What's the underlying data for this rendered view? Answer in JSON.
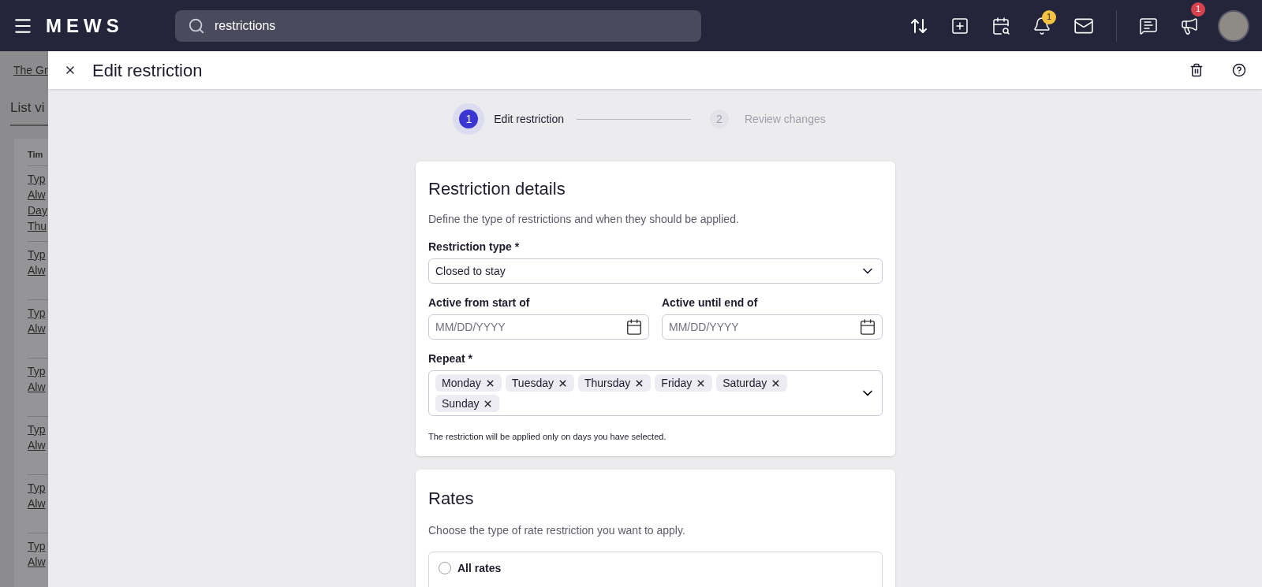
{
  "top_bar": {
    "logo": "MEWS",
    "search": {
      "value": "restrictions"
    },
    "notifications_badge": "1",
    "announcements_badge": "1"
  },
  "background_page": {
    "breadcrumb": "The Gr",
    "tab": "List vi",
    "table_header": "Tim",
    "rows": [
      [
        "Typ",
        "Alw",
        "Day",
        "Thu"
      ],
      [
        "Typ",
        "Alw"
      ],
      [
        "Typ",
        "Alw"
      ],
      [
        "Typ",
        "Alw"
      ],
      [
        "Typ",
        "Alw"
      ],
      [
        "Typ",
        "Alw"
      ],
      [
        "Typ",
        "Alw"
      ]
    ]
  },
  "panel": {
    "title": "Edit restriction",
    "steps": [
      {
        "number": "1",
        "label": "Edit restriction",
        "selected": true
      },
      {
        "number": "2",
        "label": "Review changes",
        "selected": false
      }
    ],
    "details": {
      "title": "Restriction details",
      "description": "Define the type of restrictions and when they should be applied.",
      "restriction_type": {
        "label": "Restriction type *",
        "value": "Closed to stay"
      },
      "active_from": {
        "label": "Active from start of",
        "placeholder": "MM/DD/YYYY"
      },
      "active_until": {
        "label": "Active until end of",
        "placeholder": "MM/DD/YYYY"
      },
      "repeat": {
        "label": "Repeat *",
        "chips": [
          "Monday",
          "Tuesday",
          "Thursday",
          "Friday",
          "Saturday",
          "Sunday"
        ],
        "hint": "The restriction will be applied only on days you have selected."
      }
    },
    "rates": {
      "title": "Rates",
      "description": "Choose the type of rate restriction you want to apply.",
      "options": [
        {
          "label": "All rates",
          "selected": false
        }
      ]
    }
  }
}
